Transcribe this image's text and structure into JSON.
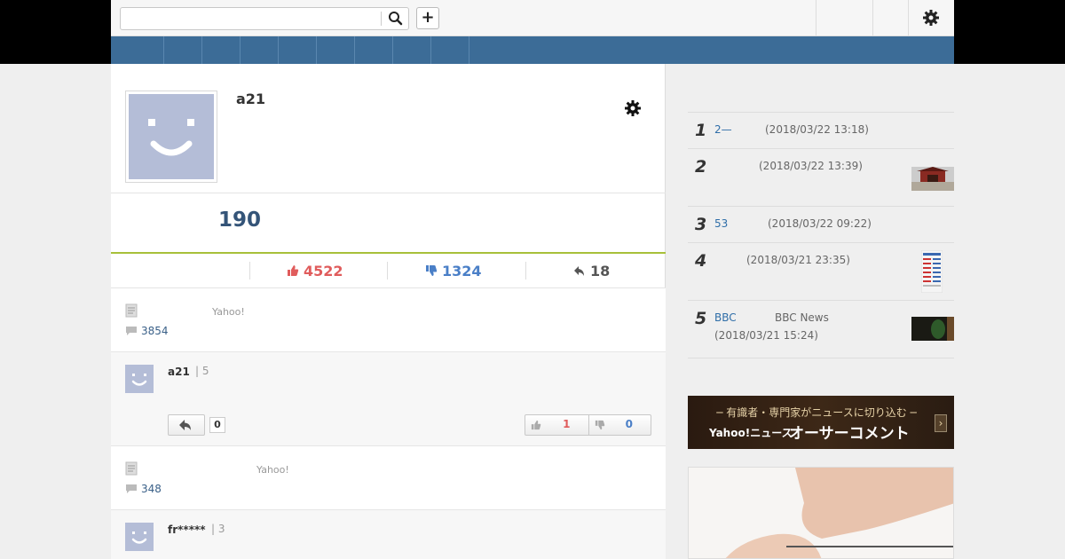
{
  "header": {
    "search_placeholder": "",
    "plus_label": "+"
  },
  "profile": {
    "name": "a21",
    "score": "190",
    "likes": "4522",
    "dislikes": "1324",
    "replies": "18"
  },
  "feed": [
    {
      "source": "Yahoo!",
      "comment_count": "3854",
      "comment": {
        "user": "a21",
        "meta": "| 5",
        "reply_count": "0",
        "likes": "1",
        "dislikes": "0"
      }
    },
    {
      "source": "Yahoo!",
      "comment_count": "348",
      "comment": {
        "user": "fr*****",
        "meta": "| 3"
      }
    }
  ],
  "ranking": [
    {
      "rank": "1",
      "link": "2—",
      "time": "(2018/03/22 13:18)"
    },
    {
      "rank": "2",
      "link": "",
      "time": "(2018/03/22 13:39)"
    },
    {
      "rank": "3",
      "link": "53",
      "time": "(2018/03/22 09:22)"
    },
    {
      "rank": "4",
      "link": "",
      "time": "(2018/03/21 23:35)"
    },
    {
      "rank": "5",
      "link": "BBC",
      "source": "BBC News",
      "time": "(2018/03/21 15:24)"
    }
  ],
  "banner": {
    "line1": "─ 有識者・専門家がニュースに切り込む ─",
    "brand": "Yahoo!ニュース",
    "title": "オーサーコメント",
    "arrow": "›"
  },
  "colors": {
    "nav": "#3c6c97",
    "like": "#e05c5c",
    "dislike": "#4a7fc7",
    "score": "#345478",
    "accent_line": "#a8c03a"
  }
}
